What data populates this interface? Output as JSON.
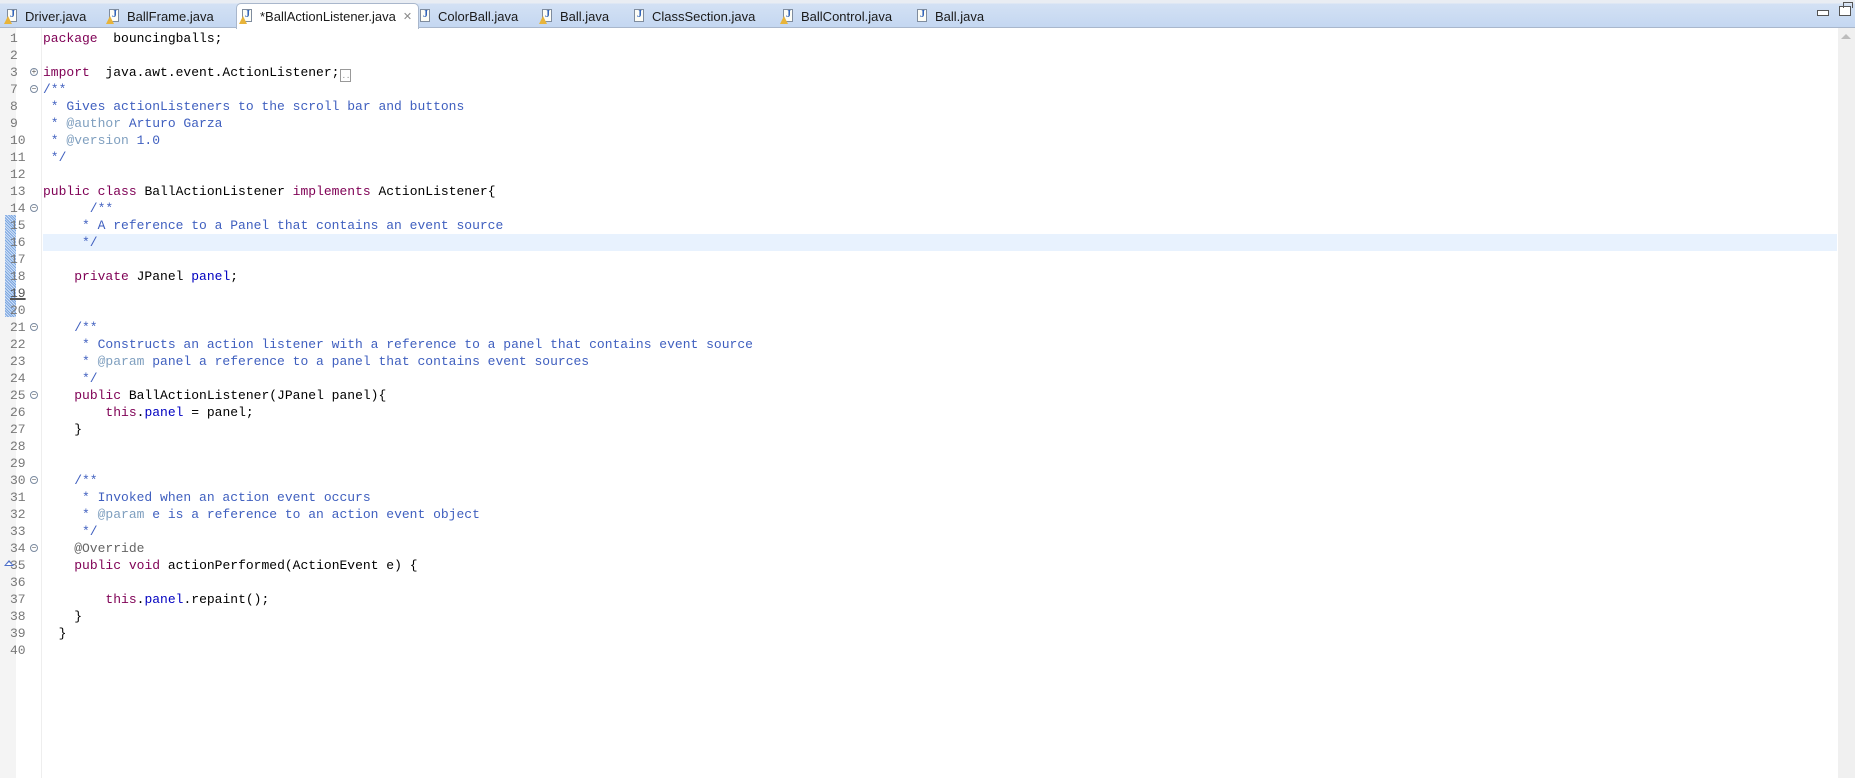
{
  "tabs": [
    {
      "label": "Driver.java",
      "warning": true,
      "active": false
    },
    {
      "label": "BallFrame.java",
      "warning": true,
      "active": false
    },
    {
      "label": "*BallActionListener.java",
      "warning": true,
      "active": true,
      "close_icon": "close-x-icon"
    },
    {
      "label": "ColorBall.java",
      "warning": false,
      "active": false
    },
    {
      "label": "Ball.java",
      "warning": true,
      "active": false
    },
    {
      "label": "ClassSection.java",
      "warning": false,
      "active": false
    },
    {
      "label": "BallControl.java",
      "warning": true,
      "active": false
    },
    {
      "label": "Ball.java",
      "warning": false,
      "active": false
    }
  ],
  "window_controls": {
    "minimize": "minimize-icon",
    "maximize": "maximize-icon"
  },
  "editor": {
    "current_line": 16,
    "lines": [
      {
        "n": "1",
        "tokens": [
          [
            "kw",
            "package"
          ],
          [
            "",
            "  bouncingballs;"
          ]
        ]
      },
      {
        "n": "2",
        "tokens": []
      },
      {
        "n": "3",
        "fold": "expand",
        "tokens": [
          [
            "kw",
            "import"
          ],
          [
            "",
            "  java.awt.event.ActionListener;"
          ]
        ],
        "collapsed": true
      },
      {
        "n": "7",
        "fold": "collapse",
        "tokens": [
          [
            "cm",
            "/**"
          ]
        ]
      },
      {
        "n": "8",
        "tokens": [
          [
            "cm",
            " * Gives actionListeners to the scroll bar and buttons"
          ]
        ]
      },
      {
        "n": "9",
        "tokens": [
          [
            "cm",
            " * "
          ],
          [
            "tag",
            "@author"
          ],
          [
            "cm",
            " Arturo Garza"
          ]
        ]
      },
      {
        "n": "10",
        "tokens": [
          [
            "cm",
            " * "
          ],
          [
            "tag",
            "@version"
          ],
          [
            "cm",
            " 1.0"
          ]
        ]
      },
      {
        "n": "11",
        "tokens": [
          [
            "cm",
            " */"
          ]
        ]
      },
      {
        "n": "12",
        "tokens": []
      },
      {
        "n": "13",
        "tokens": [
          [
            "kw",
            "public"
          ],
          [
            "",
            " "
          ],
          [
            "kw",
            "class"
          ],
          [
            "",
            " BallActionListener "
          ],
          [
            "kw",
            "implements"
          ],
          [
            "",
            " ActionListener{"
          ]
        ]
      },
      {
        "n": "14",
        "fold": "collapse",
        "tokens": [
          [
            "cm",
            "      /**"
          ]
        ]
      },
      {
        "n": "15",
        "tokens": [
          [
            "cm",
            "     * A reference to a Panel that contains an event source"
          ]
        ]
      },
      {
        "n": "16",
        "tokens": [
          [
            "cm",
            "     */"
          ]
        ]
      },
      {
        "n": "17",
        "tokens": []
      },
      {
        "n": "18",
        "tokens": [
          [
            "",
            "    "
          ],
          [
            "kw",
            "private"
          ],
          [
            "",
            " JPanel "
          ],
          [
            "fld",
            "panel"
          ],
          [
            "",
            ";"
          ]
        ]
      },
      {
        "n": "19",
        "underline": true,
        "tokens": []
      },
      {
        "n": "20",
        "tokens": []
      },
      {
        "n": "21",
        "fold": "collapse",
        "tokens": [
          [
            "cm",
            "    /**"
          ]
        ]
      },
      {
        "n": "22",
        "tokens": [
          [
            "cm",
            "     * Constructs an action listener with a reference to a panel that contains event source"
          ]
        ]
      },
      {
        "n": "23",
        "tokens": [
          [
            "cm",
            "     * "
          ],
          [
            "tag",
            "@param"
          ],
          [
            "cm",
            " panel a reference to a panel that contains event sources"
          ]
        ]
      },
      {
        "n": "24",
        "tokens": [
          [
            "cm",
            "     */"
          ]
        ]
      },
      {
        "n": "25",
        "fold": "collapse",
        "tokens": [
          [
            "",
            "    "
          ],
          [
            "kw",
            "public"
          ],
          [
            "",
            " BallActionListener(JPanel panel){"
          ]
        ]
      },
      {
        "n": "26",
        "tokens": [
          [
            "",
            "        "
          ],
          [
            "kw",
            "this"
          ],
          [
            "",
            "."
          ],
          [
            "fld",
            "panel"
          ],
          [
            "",
            " = panel;"
          ]
        ]
      },
      {
        "n": "27",
        "tokens": [
          [
            "",
            "    }"
          ]
        ]
      },
      {
        "n": "28",
        "tokens": []
      },
      {
        "n": "29",
        "tokens": []
      },
      {
        "n": "30",
        "fold": "collapse",
        "tokens": [
          [
            "cm",
            "    /**"
          ]
        ]
      },
      {
        "n": "31",
        "tokens": [
          [
            "cm",
            "     * Invoked when an action event occurs"
          ]
        ]
      },
      {
        "n": "32",
        "tokens": [
          [
            "cm",
            "     * "
          ],
          [
            "tag",
            "@param"
          ],
          [
            "cm",
            " e is a reference to an action event object"
          ]
        ]
      },
      {
        "n": "33",
        "tokens": [
          [
            "cm",
            "     */"
          ]
        ]
      },
      {
        "n": "34",
        "fold": "collapse",
        "tokens": [
          [
            "ann",
            "    @Override"
          ]
        ]
      },
      {
        "n": "35",
        "override_marker": true,
        "tokens": [
          [
            "",
            "    "
          ],
          [
            "kw",
            "public"
          ],
          [
            "",
            " "
          ],
          [
            "kw",
            "void"
          ],
          [
            "",
            " actionPerformed(ActionEvent e) {"
          ]
        ]
      },
      {
        "n": "36",
        "tokens": []
      },
      {
        "n": "37",
        "tokens": [
          [
            "",
            "        "
          ],
          [
            "kw",
            "this"
          ],
          [
            "",
            "."
          ],
          [
            "fld",
            "panel"
          ],
          [
            "",
            ".repaint();"
          ]
        ]
      },
      {
        "n": "38",
        "tokens": [
          [
            "",
            "    }"
          ]
        ]
      },
      {
        "n": "39",
        "tokens": [
          [
            "",
            "  }"
          ]
        ]
      },
      {
        "n": "40",
        "tokens": []
      }
    ]
  }
}
